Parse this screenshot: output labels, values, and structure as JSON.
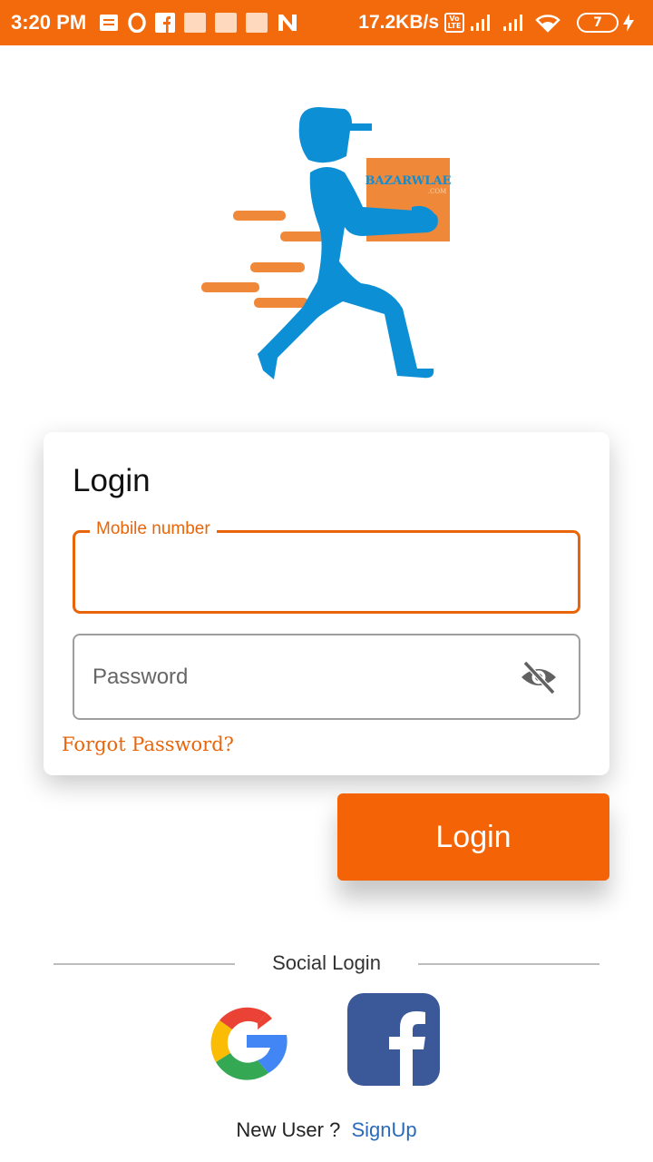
{
  "status_bar": {
    "time": "3:20 PM",
    "speed": "17.2KB/s",
    "volte": "Vo LTE",
    "battery": "7",
    "icons": [
      "notes-icon",
      "opera-icon",
      "facebook-icon",
      "news-icon",
      "news-icon",
      "news-icon",
      "n-icon",
      "signal-icon",
      "signal-icon",
      "wifi-icon",
      "battery-icon",
      "charging-icon"
    ]
  },
  "logo": {
    "brand_text": "BAZARWLAE",
    "sub_text": ".COM"
  },
  "login_card": {
    "title": "Login",
    "mobile_label": "Mobile number",
    "mobile_value": "",
    "password_placeholder": "Password",
    "forgot_password": "Forgot Password?"
  },
  "login_button": "Login",
  "social": {
    "title": "Social Login",
    "providers": [
      "google-icon",
      "facebook-icon"
    ]
  },
  "signup": {
    "prompt": "New User ?",
    "link": "SignUp"
  },
  "colors": {
    "accent": "#f46407",
    "status_bar": "#f26a0c",
    "link": "#2a6ab8",
    "facebook": "#3b5998",
    "logo_blue": "#0d8fd6"
  }
}
